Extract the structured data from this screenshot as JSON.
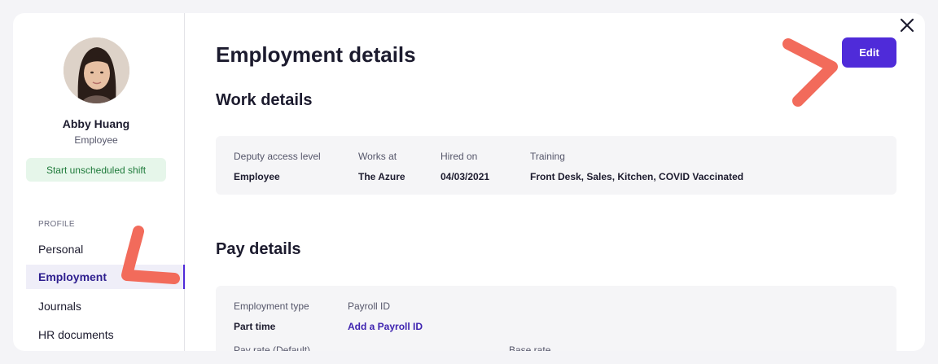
{
  "profile": {
    "name": "Abby Huang",
    "role": "Employee",
    "shift_button": "Start unscheduled shift"
  },
  "sidebar": {
    "section_label": "PROFILE",
    "items": [
      {
        "label": "Personal",
        "active": false
      },
      {
        "label": "Employment",
        "active": true
      },
      {
        "label": "Journals",
        "active": false
      },
      {
        "label": "HR documents",
        "active": false
      }
    ]
  },
  "main": {
    "title": "Employment details",
    "edit_label": "Edit",
    "work_details": {
      "heading": "Work details",
      "fields": [
        {
          "label": "Deputy access level",
          "value": "Employee"
        },
        {
          "label": "Works at",
          "value": "The Azure"
        },
        {
          "label": "Hired on",
          "value": "04/03/2021"
        },
        {
          "label": "Training",
          "value": "Front Desk, Sales, Kitchen, COVID Vaccinated"
        }
      ]
    },
    "pay_details": {
      "heading": "Pay details",
      "fields": [
        {
          "label": "Employment type",
          "value": "Part time"
        },
        {
          "label": "Payroll ID",
          "value": "Add a Payroll ID"
        },
        {
          "label": "Pay rate (Default)",
          "value": ""
        },
        {
          "label": "Base rate",
          "value": ""
        }
      ]
    }
  },
  "colors": {
    "accent": "#4f2bd9",
    "shift_green": "#1e7a3a",
    "annotation": "#f26b5b"
  },
  "icons": [
    "close-icon",
    "avatar-photo"
  ]
}
